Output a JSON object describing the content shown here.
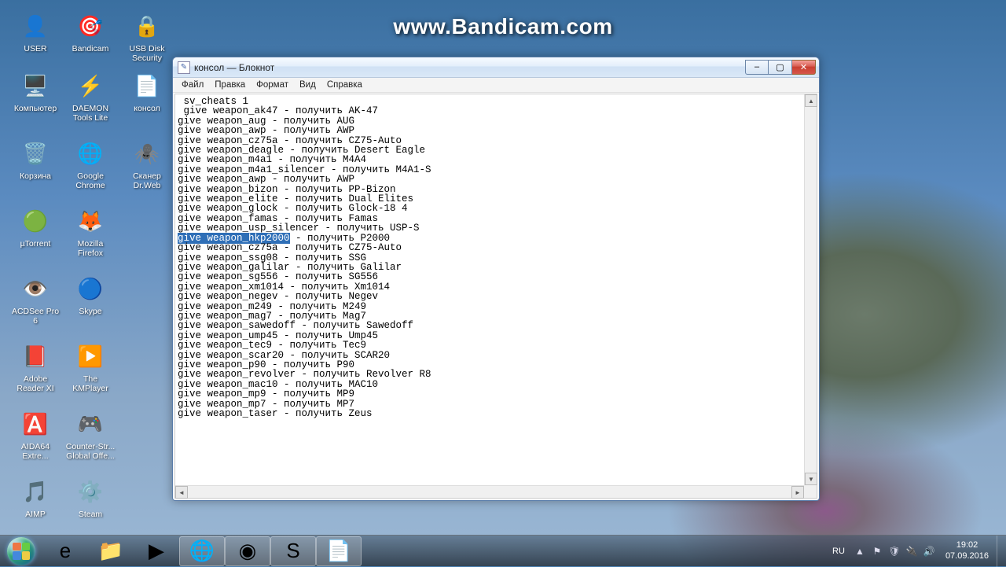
{
  "watermark": "www.Bandicam.com",
  "desktop_icons": [
    {
      "name": "user-icon",
      "label": "USER",
      "glyph": "👤",
      "bg": ""
    },
    {
      "name": "bandicam-icon",
      "label": "Bandicam",
      "glyph": "🎯",
      "bg": ""
    },
    {
      "name": "usb-disk-security-icon",
      "label": "USB Disk Security",
      "glyph": "🔒",
      "bg": ""
    },
    {
      "name": "computer-icon",
      "label": "Компьютер",
      "glyph": "🖥️",
      "bg": ""
    },
    {
      "name": "daemon-tools-icon",
      "label": "DAEMON Tools Lite",
      "glyph": "⚡",
      "bg": ""
    },
    {
      "name": "konsol-icon",
      "label": "консол",
      "glyph": "📄",
      "bg": ""
    },
    {
      "name": "recycle-bin-icon",
      "label": "Корзина",
      "glyph": "🗑️",
      "bg": ""
    },
    {
      "name": "chrome-icon",
      "label": "Google Chrome",
      "glyph": "🌐",
      "bg": ""
    },
    {
      "name": "drweb-scanner-icon",
      "label": "Сканер Dr.Web",
      "glyph": "🕷️",
      "bg": ""
    },
    {
      "name": "utorrent-icon",
      "label": "µTorrent",
      "glyph": "🟢",
      "bg": ""
    },
    {
      "name": "firefox-icon",
      "label": "Mozilla Firefox",
      "glyph": "🦊",
      "bg": ""
    },
    {
      "name": "acdsee-icon",
      "label": "ACDSee Pro 6",
      "glyph": "👁️",
      "bg": ""
    },
    {
      "name": "skype-icon",
      "label": "Skype",
      "glyph": "🔵",
      "bg": ""
    },
    {
      "name": "adobe-reader-icon",
      "label": "Adobe Reader XI",
      "glyph": "📕",
      "bg": ""
    },
    {
      "name": "kmplayer-icon",
      "label": "The KMPlayer",
      "glyph": "▶️",
      "bg": ""
    },
    {
      "name": "aida64-icon",
      "label": "AIDA64 Extre...",
      "glyph": "🅰️",
      "bg": ""
    },
    {
      "name": "csgo-icon",
      "label": "Counter-Str... Global Offe...",
      "glyph": "🎮",
      "bg": ""
    },
    {
      "name": "aimp-icon",
      "label": "AIMP",
      "glyph": "🎵",
      "bg": ""
    },
    {
      "name": "steam-icon",
      "label": "Steam",
      "glyph": "⚙️",
      "bg": ""
    }
  ],
  "window": {
    "title": "консол — Блокнот",
    "menus": [
      "Файл",
      "Правка",
      "Формат",
      "Вид",
      "Справка"
    ],
    "min_label": "–",
    "max_label": "▢",
    "close_label": "✕"
  },
  "editor": {
    "selected_line_index": 14,
    "selected_text": "give weapon_hkp2000",
    "selected_rest": " - получить P2000",
    "lines_before": [
      " sv_cheats 1",
      "",
      " give weapon_ak47 - получить AK-47",
      "give weapon_aug - получить AUG",
      "give weapon_awp - получить AWP",
      "give weapon_cz75a - получить CZ75-Auto",
      "give weapon_deagle - получить Desert Eagle",
      "give weapon_m4a1 - получить M4A4",
      "give weapon_m4a1_silencer - получить M4A1-S",
      "give weapon_awp - получить AWP",
      "give weapon_bizon - получить PP-Bizon",
      "give weapon_elite - получить Dual Elites",
      "give weapon_glock - получить Glock-18 4",
      "give weapon_famas - получить Famas",
      "give weapon_usp_silencer - получить USP-S"
    ],
    "lines_after": [
      "give weapon_cz75a - получить CZ75-Auto",
      "give weapon_ssg08 - получить SSG",
      "give weapon_galilar - получить Galilar",
      "give weapon_sg556 - получить SG556",
      "give weapon_xm1014 - получить Xm1014",
      "give weapon_negev - получить Negev",
      "give weapon_m249 - получить M249",
      "give weapon_mag7 - получить Mag7",
      "give weapon_sawedoff - получить Sawedoff",
      "give weapon_ump45 - получить Ump45",
      "give weapon_tec9 - получить Tec9",
      "give weapon_scar20 - получить SCAR20",
      "give weapon_p90 - получить P90",
      "give weapon_revolver - получить Revolver R8",
      "give weapon_mac10 - получить MAC10",
      "give weapon_mp9 - получить MP9",
      "give weapon_mp7 - получить MP7",
      "give weapon_taser - получить Zeus"
    ]
  },
  "taskbar": {
    "apps": [
      {
        "name": "tb-ie",
        "glyph": "e",
        "active": false
      },
      {
        "name": "tb-explorer",
        "glyph": "📁",
        "active": false
      },
      {
        "name": "tb-media",
        "glyph": "▶",
        "active": false
      },
      {
        "name": "tb-chrome",
        "glyph": "🌐",
        "active": true
      },
      {
        "name": "tb-steam",
        "glyph": "◉",
        "active": true
      },
      {
        "name": "tb-skype",
        "glyph": "S",
        "active": true
      },
      {
        "name": "tb-notepad",
        "glyph": "📄",
        "active": true
      }
    ],
    "lang": "RU",
    "tray_icons": [
      "▲",
      "⚑",
      "🛡",
      "🔌",
      "🔊"
    ],
    "time": "19:02",
    "date": "07.09.2016"
  }
}
